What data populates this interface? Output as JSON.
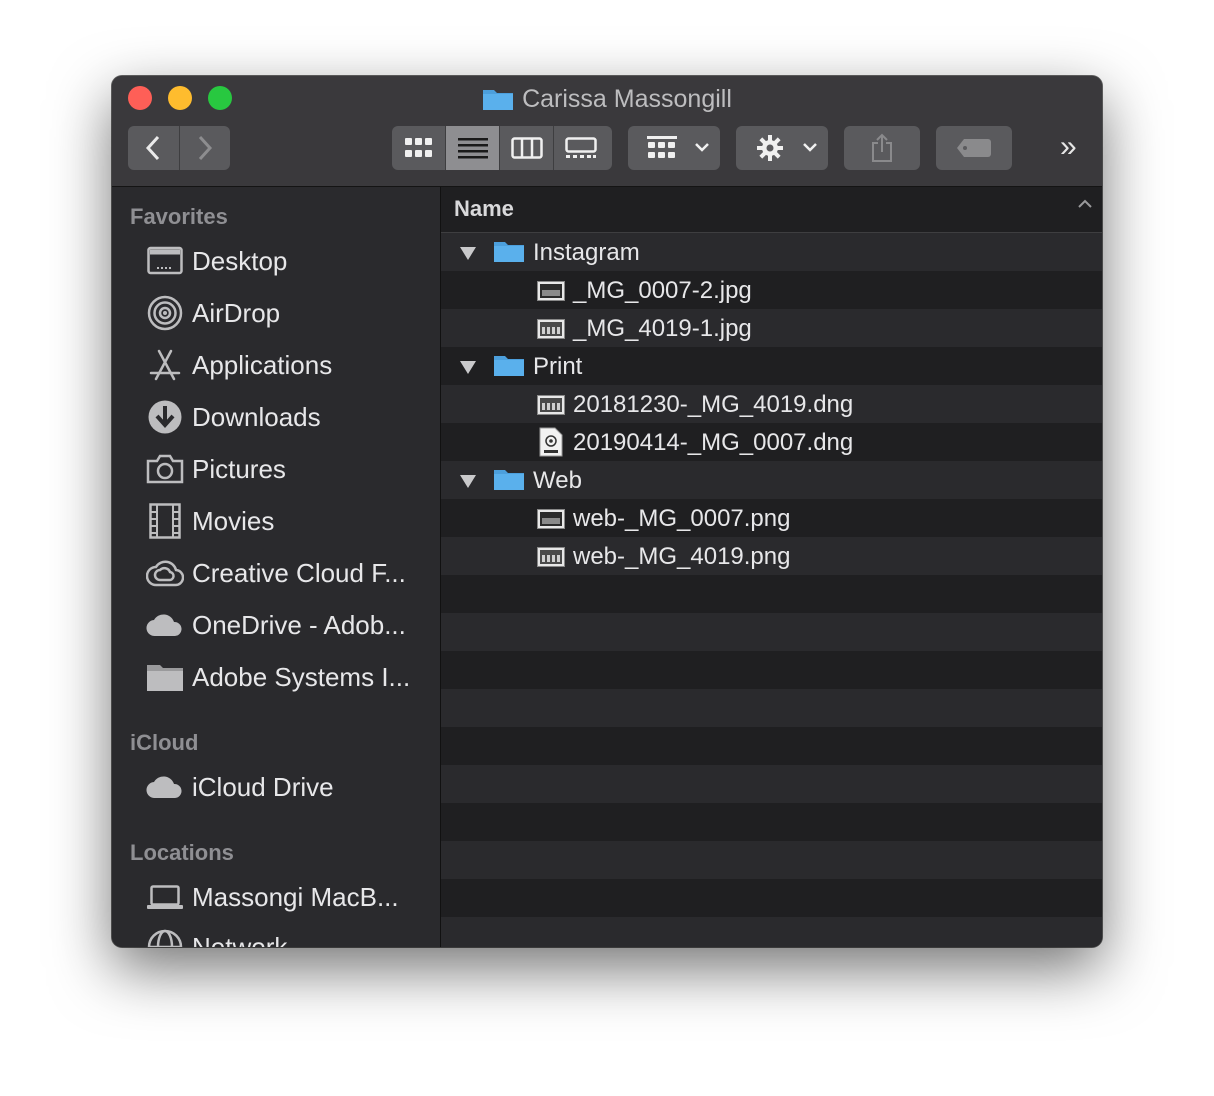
{
  "window": {
    "title": "Carissa Massongill"
  },
  "toolbar": {
    "back": "back-icon",
    "forward": "forward-icon",
    "view_modes": [
      "icon-view",
      "list-view",
      "column-view",
      "gallery-view"
    ],
    "active_view": "list-view",
    "overflow": "»"
  },
  "sidebar": {
    "favorites_label": "Favorites",
    "favorites": [
      {
        "label": "Desktop",
        "icon": "desktop-icon"
      },
      {
        "label": "AirDrop",
        "icon": "airdrop-icon"
      },
      {
        "label": "Applications",
        "icon": "applications-icon"
      },
      {
        "label": "Downloads",
        "icon": "downloads-icon"
      },
      {
        "label": "Pictures",
        "icon": "camera-icon"
      },
      {
        "label": "Movies",
        "icon": "film-icon"
      },
      {
        "label": "Creative Cloud F...",
        "icon": "creative-cloud-icon"
      },
      {
        "label": "OneDrive - Adob...",
        "icon": "cloud-icon"
      },
      {
        "label": "Adobe Systems I...",
        "icon": "folder-icon"
      }
    ],
    "icloud_label": "iCloud",
    "icloud": [
      {
        "label": "iCloud Drive",
        "icon": "cloud-icon"
      }
    ],
    "locations_label": "Locations",
    "locations": [
      {
        "label": "Massongi MacB...",
        "icon": "laptop-icon"
      },
      {
        "label": "Network",
        "icon": "network-icon"
      }
    ]
  },
  "list": {
    "column_name": "Name",
    "rows": [
      {
        "name": "Instagram",
        "type": "folder",
        "expanded": true
      },
      {
        "name": "_MG_0007-2.jpg",
        "type": "image"
      },
      {
        "name": "_MG_4019-1.jpg",
        "type": "image"
      },
      {
        "name": "Print",
        "type": "folder",
        "expanded": true
      },
      {
        "name": "20181230-_MG_4019.dng",
        "type": "image"
      },
      {
        "name": "20190414-_MG_0007.dng",
        "type": "dng"
      },
      {
        "name": "Web",
        "type": "folder",
        "expanded": true
      },
      {
        "name": "web-_MG_0007.png",
        "type": "image"
      },
      {
        "name": "web-_MG_4019.png",
        "type": "image"
      }
    ]
  },
  "colors": {
    "folder_blue": "#5ab0ec",
    "close": "#fe5f57",
    "minimize": "#febc2e",
    "maximize": "#28c840"
  }
}
